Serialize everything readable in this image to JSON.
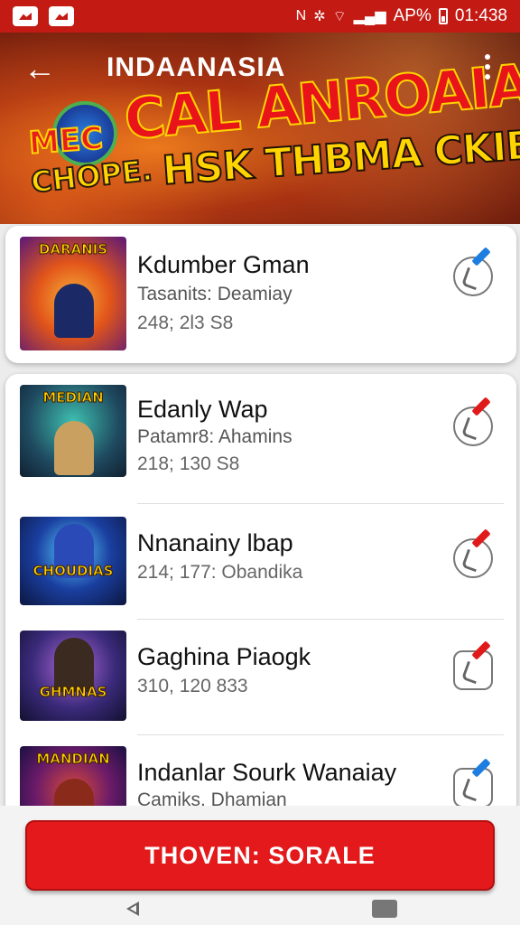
{
  "status_bar": {
    "battery_text": "AP%",
    "time": "01:438",
    "icons": [
      "gallery-icon",
      "gallery-icon",
      "nfc-icon",
      "vibrate-icon",
      "wifi-icon",
      "signal-icon",
      "battery-icon"
    ]
  },
  "header": {
    "title": "INDAANASIA",
    "banner_line_1": "CAL ANROAIA.",
    "banner_line_2": "HSK THBMA CKIB",
    "logo_line_1": "MEC",
    "logo_line_2": "CHOPE."
  },
  "list": {
    "items": [
      {
        "title": "Kdumber Gman",
        "subtitle": "Tasanits: Deamiay",
        "meta": "248; 2l3 S8",
        "thumb_label": "DARANIS",
        "action_icon": "edit-icon"
      },
      {
        "title": "Edanly Wap",
        "subtitle": "Patamr8: Ahamins",
        "meta": "218; 130 S8",
        "thumb_label": "MEDIAN",
        "action_icon": "edit-icon"
      },
      {
        "title": "Nnanainy lbap",
        "subtitle": "",
        "meta": "214; 177: Obandika",
        "thumb_label": "CHOUDIAS",
        "action_icon": "edit-icon"
      },
      {
        "title": "Gaghina Piaogk",
        "subtitle": "",
        "meta": "310, 120 833",
        "thumb_label": "GHMNAS",
        "action_icon": "share-icon"
      },
      {
        "title": "Indanlar Sourk Wanaiay",
        "subtitle": "Camiks. Dhamian",
        "meta": "",
        "thumb_label": "MANDIAN",
        "action_icon": "like-icon"
      }
    ]
  },
  "cta": {
    "label": "THOVEN: SORALE"
  },
  "colors": {
    "primary": "#e3191b",
    "header": "#c41a14",
    "accent_blue": "#1e7de0"
  }
}
